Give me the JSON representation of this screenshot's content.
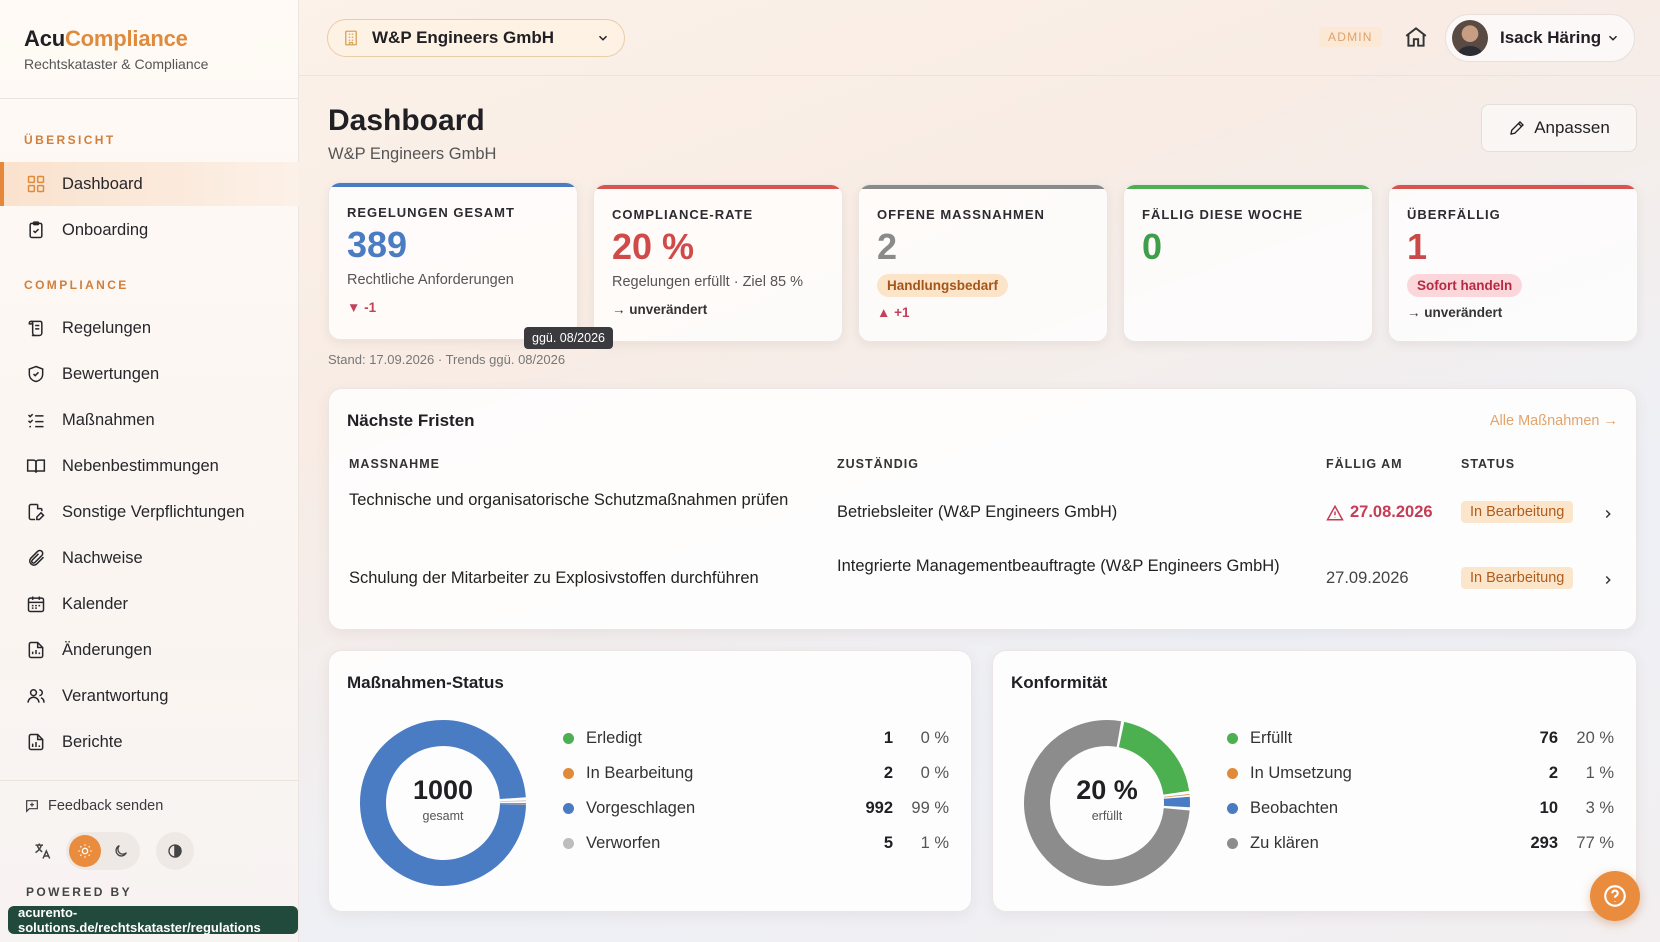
{
  "brand": {
    "name_part1": "Acu",
    "name_part2": "Compliance",
    "subtitle": "Rechtskataster & Compliance"
  },
  "sidebar": {
    "section_overview": "ÜBERSICHT",
    "section_compliance": "COMPLIANCE",
    "items": [
      {
        "label": "Dashboard",
        "icon": "grid-icon",
        "active": true
      },
      {
        "label": "Onboarding",
        "icon": "clipboard-icon"
      },
      {
        "label": "Regelungen",
        "icon": "scroll-icon"
      },
      {
        "label": "Bewertungen",
        "icon": "shield-check-icon"
      },
      {
        "label": "Maßnahmen",
        "icon": "checklist-icon"
      },
      {
        "label": "Nebenbestimmungen",
        "icon": "book-open-icon"
      },
      {
        "label": "Sonstige Verpflichtungen",
        "icon": "file-edit-icon"
      },
      {
        "label": "Nachweise",
        "icon": "paperclip-icon"
      },
      {
        "label": "Kalender",
        "icon": "calendar-icon"
      },
      {
        "label": "Änderungen",
        "icon": "file-chart-icon"
      },
      {
        "label": "Verantwortung",
        "icon": "users-icon"
      },
      {
        "label": "Berichte",
        "icon": "report-icon"
      }
    ],
    "feedback": "Feedback senden",
    "powered_by": "POWERED BY",
    "url": "acurento-solutions.de/rechtskataster/regulations"
  },
  "topbar": {
    "org": "W&P Engineers GmbH",
    "admin_badge": "ADMIN",
    "user_name": "Isack Häring"
  },
  "page": {
    "title": "Dashboard",
    "subtitle": "W&P Engineers GmbH",
    "customize_label": "Anpassen",
    "tooltip": "ggü. 08/2026",
    "stand": "Stand: 17.09.2026 · Trends ggü. 08/2026"
  },
  "kpis": [
    {
      "label": "REGELUNGEN GESAMT",
      "value": "389",
      "desc": "Rechtliche Anforderungen",
      "trend": "▼ -1",
      "bar": "#4a7cc4",
      "value_color": "#4a7cc4"
    },
    {
      "label": "COMPLIANCE-RATE",
      "value": "20 %",
      "desc": "Regelungen erfüllt · Ziel 85 %",
      "trend": "→ unverändert",
      "bar": "#d9534f",
      "value_color": "#d04a4a"
    },
    {
      "label": "OFFENE MASSNAHMEN",
      "value": "2",
      "badge": "Handlungsbedarf",
      "trend": "▲ +1",
      "bar": "#8a8a8a",
      "value_color": "#8a8a8a"
    },
    {
      "label": "FÄLLIG DIESE WOCHE",
      "value": "0",
      "bar": "#4caf50",
      "value_color": "#3e9e4a"
    },
    {
      "label": "ÜBERFÄLLIG",
      "value": "1",
      "badge": "Sofort handeln",
      "trend": "→ unverändert",
      "bar": "#d9534f",
      "value_color": "#c94848"
    }
  ],
  "deadlines": {
    "title": "Nächste Fristen",
    "all_link": "Alle Maßnahmen →",
    "headers": [
      "MASSNAHME",
      "ZUSTÄNDIG",
      "FÄLLIG AM",
      "STATUS"
    ],
    "rows": [
      {
        "measure": "Technische und organisatorische Schutzmaßnahmen prüfen",
        "owner": "Betriebsleiter (W&P Engineers GmbH)",
        "due": "27.08.2026",
        "overdue": true,
        "status": "In Bearbeitung"
      },
      {
        "measure": "Schulung der Mitarbeiter zu Explosivstoffen durchführen",
        "owner": "Integrierte Managementbeauftragte (W&P Engineers GmbH)",
        "due": "27.09.2026",
        "overdue": false,
        "status": "In Bearbeitung"
      }
    ]
  },
  "measures_status": {
    "title": "Maßnahmen-Status",
    "center_value": "1000",
    "center_label": "gesamt",
    "chart_data": {
      "type": "pie",
      "categories": [
        "Erledigt",
        "In Bearbeitung",
        "Vorgeschlagen",
        "Verworfen"
      ],
      "values": [
        1,
        2,
        992,
        5
      ],
      "percents": [
        "0 %",
        "0 %",
        "99 %",
        "1 %"
      ],
      "colors": [
        "#4caf50",
        "#e08a3c",
        "#4a7cc4",
        "#bdbdbd"
      ]
    }
  },
  "conformity": {
    "title": "Konformität",
    "center_value": "20 %",
    "center_label": "erfüllt",
    "chart_data": {
      "type": "pie",
      "categories": [
        "Erfüllt",
        "In Umsetzung",
        "Beobachten",
        "Zu klären"
      ],
      "values": [
        76,
        2,
        10,
        293
      ],
      "percents": [
        "20 %",
        "1 %",
        "3 %",
        "77 %"
      ],
      "colors": [
        "#4caf50",
        "#e08a3c",
        "#4a7cc4",
        "#8c8c8c"
      ]
    }
  }
}
